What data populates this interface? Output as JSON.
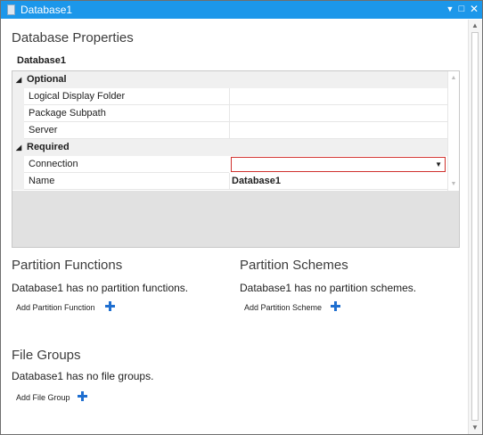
{
  "window": {
    "title": "Database1"
  },
  "header": {
    "title": "Database Properties",
    "subtitle": "Database1"
  },
  "property_grid": {
    "categories": [
      {
        "label": "Optional",
        "properties": [
          {
            "name": "Logical Display Folder",
            "value": ""
          },
          {
            "name": "Package Subpath",
            "value": ""
          },
          {
            "name": "Server",
            "value": ""
          }
        ]
      },
      {
        "label": "Required",
        "properties": [
          {
            "name": "Connection",
            "value": ""
          },
          {
            "name": "Name",
            "value": "Database1"
          }
        ]
      }
    ]
  },
  "partition_functions": {
    "title": "Partition Functions",
    "empty_text": "Database1 has no partition functions.",
    "add_label": "Add Partition Function"
  },
  "partition_schemes": {
    "title": "Partition Schemes",
    "empty_text": "Database1 has no partition schemes.",
    "add_label": "Add Partition Scheme"
  },
  "file_groups": {
    "title": "File Groups",
    "empty_text": "Database1 has no file groups.",
    "add_label": "Add File Group"
  },
  "colors": {
    "titlebar": "#1c97ea",
    "accent_plus": "#1f6fd0",
    "error_border": "#d0312d"
  }
}
